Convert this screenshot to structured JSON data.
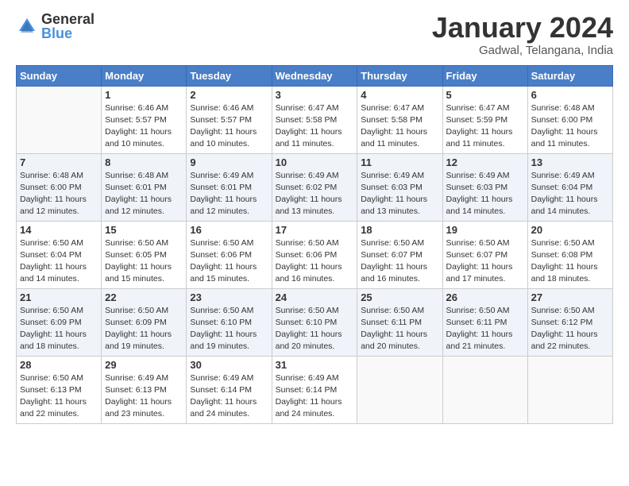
{
  "header": {
    "logo_general": "General",
    "logo_blue": "Blue",
    "month_title": "January 2024",
    "location": "Gadwal, Telangana, India"
  },
  "days_of_week": [
    "Sunday",
    "Monday",
    "Tuesday",
    "Wednesday",
    "Thursday",
    "Friday",
    "Saturday"
  ],
  "weeks": [
    [
      {
        "day": "",
        "info": ""
      },
      {
        "day": "1",
        "info": "Sunrise: 6:46 AM\nSunset: 5:57 PM\nDaylight: 11 hours\nand 10 minutes."
      },
      {
        "day": "2",
        "info": "Sunrise: 6:46 AM\nSunset: 5:57 PM\nDaylight: 11 hours\nand 10 minutes."
      },
      {
        "day": "3",
        "info": "Sunrise: 6:47 AM\nSunset: 5:58 PM\nDaylight: 11 hours\nand 11 minutes."
      },
      {
        "day": "4",
        "info": "Sunrise: 6:47 AM\nSunset: 5:58 PM\nDaylight: 11 hours\nand 11 minutes."
      },
      {
        "day": "5",
        "info": "Sunrise: 6:47 AM\nSunset: 5:59 PM\nDaylight: 11 hours\nand 11 minutes."
      },
      {
        "day": "6",
        "info": "Sunrise: 6:48 AM\nSunset: 6:00 PM\nDaylight: 11 hours\nand 11 minutes."
      }
    ],
    [
      {
        "day": "7",
        "info": "Sunrise: 6:48 AM\nSunset: 6:00 PM\nDaylight: 11 hours\nand 12 minutes."
      },
      {
        "day": "8",
        "info": "Sunrise: 6:48 AM\nSunset: 6:01 PM\nDaylight: 11 hours\nand 12 minutes."
      },
      {
        "day": "9",
        "info": "Sunrise: 6:49 AM\nSunset: 6:01 PM\nDaylight: 11 hours\nand 12 minutes."
      },
      {
        "day": "10",
        "info": "Sunrise: 6:49 AM\nSunset: 6:02 PM\nDaylight: 11 hours\nand 13 minutes."
      },
      {
        "day": "11",
        "info": "Sunrise: 6:49 AM\nSunset: 6:03 PM\nDaylight: 11 hours\nand 13 minutes."
      },
      {
        "day": "12",
        "info": "Sunrise: 6:49 AM\nSunset: 6:03 PM\nDaylight: 11 hours\nand 14 minutes."
      },
      {
        "day": "13",
        "info": "Sunrise: 6:49 AM\nSunset: 6:04 PM\nDaylight: 11 hours\nand 14 minutes."
      }
    ],
    [
      {
        "day": "14",
        "info": "Sunrise: 6:50 AM\nSunset: 6:04 PM\nDaylight: 11 hours\nand 14 minutes."
      },
      {
        "day": "15",
        "info": "Sunrise: 6:50 AM\nSunset: 6:05 PM\nDaylight: 11 hours\nand 15 minutes."
      },
      {
        "day": "16",
        "info": "Sunrise: 6:50 AM\nSunset: 6:06 PM\nDaylight: 11 hours\nand 15 minutes."
      },
      {
        "day": "17",
        "info": "Sunrise: 6:50 AM\nSunset: 6:06 PM\nDaylight: 11 hours\nand 16 minutes."
      },
      {
        "day": "18",
        "info": "Sunrise: 6:50 AM\nSunset: 6:07 PM\nDaylight: 11 hours\nand 16 minutes."
      },
      {
        "day": "19",
        "info": "Sunrise: 6:50 AM\nSunset: 6:07 PM\nDaylight: 11 hours\nand 17 minutes."
      },
      {
        "day": "20",
        "info": "Sunrise: 6:50 AM\nSunset: 6:08 PM\nDaylight: 11 hours\nand 18 minutes."
      }
    ],
    [
      {
        "day": "21",
        "info": "Sunrise: 6:50 AM\nSunset: 6:09 PM\nDaylight: 11 hours\nand 18 minutes."
      },
      {
        "day": "22",
        "info": "Sunrise: 6:50 AM\nSunset: 6:09 PM\nDaylight: 11 hours\nand 19 minutes."
      },
      {
        "day": "23",
        "info": "Sunrise: 6:50 AM\nSunset: 6:10 PM\nDaylight: 11 hours\nand 19 minutes."
      },
      {
        "day": "24",
        "info": "Sunrise: 6:50 AM\nSunset: 6:10 PM\nDaylight: 11 hours\nand 20 minutes."
      },
      {
        "day": "25",
        "info": "Sunrise: 6:50 AM\nSunset: 6:11 PM\nDaylight: 11 hours\nand 20 minutes."
      },
      {
        "day": "26",
        "info": "Sunrise: 6:50 AM\nSunset: 6:11 PM\nDaylight: 11 hours\nand 21 minutes."
      },
      {
        "day": "27",
        "info": "Sunrise: 6:50 AM\nSunset: 6:12 PM\nDaylight: 11 hours\nand 22 minutes."
      }
    ],
    [
      {
        "day": "28",
        "info": "Sunrise: 6:50 AM\nSunset: 6:13 PM\nDaylight: 11 hours\nand 22 minutes."
      },
      {
        "day": "29",
        "info": "Sunrise: 6:49 AM\nSunset: 6:13 PM\nDaylight: 11 hours\nand 23 minutes."
      },
      {
        "day": "30",
        "info": "Sunrise: 6:49 AM\nSunset: 6:14 PM\nDaylight: 11 hours\nand 24 minutes."
      },
      {
        "day": "31",
        "info": "Sunrise: 6:49 AM\nSunset: 6:14 PM\nDaylight: 11 hours\nand 24 minutes."
      },
      {
        "day": "",
        "info": ""
      },
      {
        "day": "",
        "info": ""
      },
      {
        "day": "",
        "info": ""
      }
    ]
  ]
}
